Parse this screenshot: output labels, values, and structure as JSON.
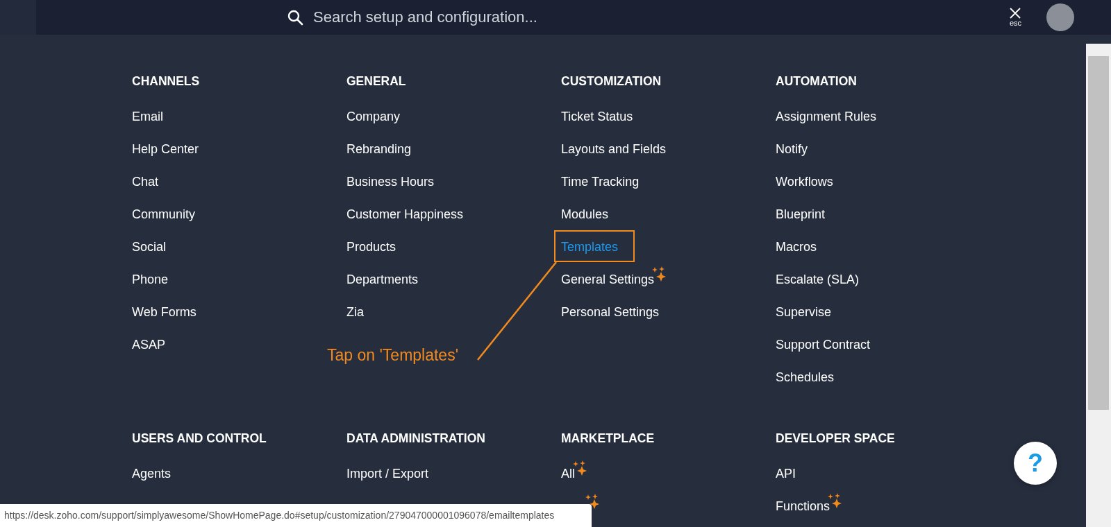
{
  "search": {
    "placeholder": "Search setup and configuration..."
  },
  "close": {
    "label": "esc"
  },
  "sections": [
    {
      "title": "CHANNELS",
      "items": [
        {
          "label": "Email",
          "selected": false,
          "new": false
        },
        {
          "label": "Help Center",
          "selected": false,
          "new": false
        },
        {
          "label": "Chat",
          "selected": false,
          "new": false
        },
        {
          "label": "Community",
          "selected": false,
          "new": false
        },
        {
          "label": "Social",
          "selected": false,
          "new": false
        },
        {
          "label": "Phone",
          "selected": false,
          "new": false
        },
        {
          "label": "Web Forms",
          "selected": false,
          "new": false
        },
        {
          "label": "ASAP",
          "selected": false,
          "new": false
        }
      ]
    },
    {
      "title": "GENERAL",
      "items": [
        {
          "label": "Company",
          "selected": false,
          "new": false
        },
        {
          "label": "Rebranding",
          "selected": false,
          "new": false
        },
        {
          "label": "Business Hours",
          "selected": false,
          "new": false
        },
        {
          "label": "Customer Happiness",
          "selected": false,
          "new": false
        },
        {
          "label": "Products",
          "selected": false,
          "new": false
        },
        {
          "label": "Departments",
          "selected": false,
          "new": false
        },
        {
          "label": "Zia",
          "selected": false,
          "new": false
        }
      ]
    },
    {
      "title": "CUSTOMIZATION",
      "items": [
        {
          "label": "Ticket Status",
          "selected": false,
          "new": false
        },
        {
          "label": "Layouts and Fields",
          "selected": false,
          "new": false
        },
        {
          "label": "Time Tracking",
          "selected": false,
          "new": false
        },
        {
          "label": "Modules",
          "selected": false,
          "new": false
        },
        {
          "label": "Templates",
          "selected": true,
          "new": false
        },
        {
          "label": "General Settings",
          "selected": false,
          "new": true
        },
        {
          "label": "Personal Settings",
          "selected": false,
          "new": false
        }
      ]
    },
    {
      "title": "AUTOMATION",
      "items": [
        {
          "label": "Assignment Rules",
          "selected": false,
          "new": false
        },
        {
          "label": "Notify",
          "selected": false,
          "new": false
        },
        {
          "label": "Workflows",
          "selected": false,
          "new": false
        },
        {
          "label": "Blueprint",
          "selected": false,
          "new": false
        },
        {
          "label": "Macros",
          "selected": false,
          "new": false
        },
        {
          "label": "Escalate (SLA)",
          "selected": false,
          "new": false
        },
        {
          "label": "Supervise",
          "selected": false,
          "new": false
        },
        {
          "label": "Support Contract",
          "selected": false,
          "new": false
        },
        {
          "label": "Schedules",
          "selected": false,
          "new": false
        }
      ]
    },
    {
      "title": "USERS AND CONTROL",
      "items": [
        {
          "label": "Agents",
          "selected": false,
          "new": false
        }
      ]
    },
    {
      "title": "DATA ADMINISTRATION",
      "items": [
        {
          "label": "Import / Export",
          "selected": false,
          "new": false
        }
      ]
    },
    {
      "title": "MARKETPLACE",
      "items": [
        {
          "label": "All",
          "selected": false,
          "new": true
        }
      ]
    },
    {
      "title": "DEVELOPER SPACE",
      "items": [
        {
          "label": "API",
          "selected": false,
          "new": false
        },
        {
          "label": "Functions",
          "selected": false,
          "new": true
        }
      ]
    }
  ],
  "annotation": {
    "text": "Tap on 'Templates'"
  },
  "help": {
    "label": "?"
  },
  "status_url": "https://desk.zoho.com/support/simplyawesome/ShowHomePage.do#setup/customization/279047000001096078/emailtemplates"
}
